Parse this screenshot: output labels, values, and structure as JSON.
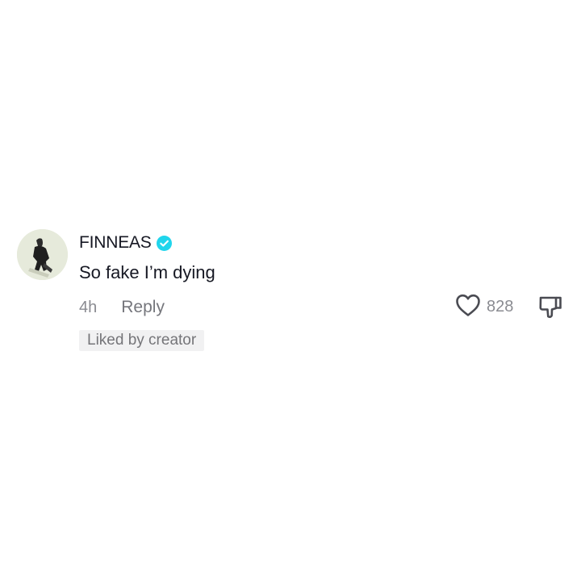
{
  "comment": {
    "username": "FINNEAS",
    "verified_icon": "verified-badge-icon",
    "text": "So fake I’m dying",
    "time": "4h",
    "reply_label": "Reply",
    "like_icon": "heart-outline-icon",
    "like_count": "828",
    "dislike_icon": "thumbs-down-icon",
    "liked_by_creator": "Liked by creator"
  },
  "colors": {
    "verified": "#20d5ec",
    "text_primary": "#161823",
    "text_secondary": "#8a8b91",
    "badge_bg": "#f1f1f2"
  }
}
